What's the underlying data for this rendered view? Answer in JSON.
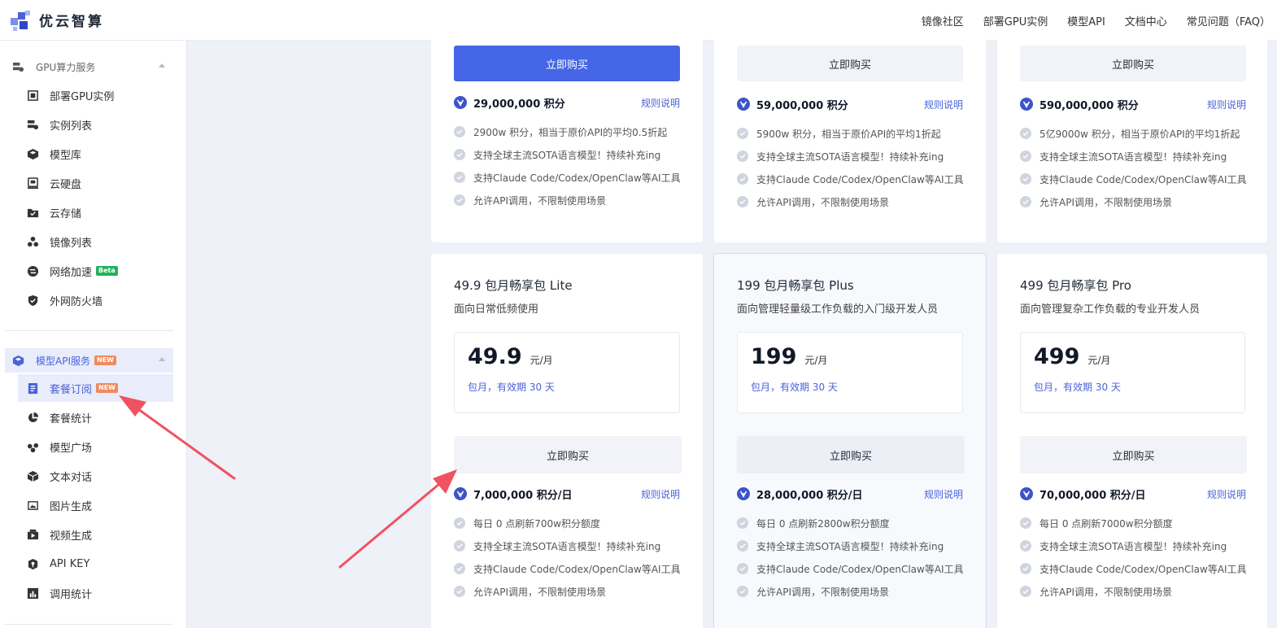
{
  "brand": {
    "name": "优云智算"
  },
  "topnav": [
    {
      "label": "镜像社区"
    },
    {
      "label": "部署GPU实例"
    },
    {
      "label": "模型API"
    },
    {
      "label": "文档中心"
    },
    {
      "label": "常见问题（FAQ）"
    }
  ],
  "sidebar": {
    "groups": [
      {
        "label": "GPU算力服务",
        "icon": "server-icon",
        "items": [
          {
            "label": "部署GPU实例",
            "icon": "deploy-icon"
          },
          {
            "label": "实例列表",
            "icon": "instance-list-icon"
          },
          {
            "label": "模型库",
            "icon": "model-library-icon"
          },
          {
            "label": "云硬盘",
            "icon": "cloud-disk-icon"
          },
          {
            "label": "云存储",
            "icon": "cloud-storage-icon"
          },
          {
            "label": "镜像列表",
            "icon": "image-list-icon"
          },
          {
            "label": "网络加速",
            "icon": "network-accel-icon",
            "badge": "Beta"
          },
          {
            "label": "外网防火墙",
            "icon": "firewall-icon"
          }
        ]
      },
      {
        "label": "模型API服务",
        "icon": "cube-icon",
        "badge": "NEW",
        "items": [
          {
            "label": "套餐订阅",
            "icon": "subscription-icon",
            "badge": "NEW",
            "active": true
          },
          {
            "label": "套餐统计",
            "icon": "pie-chart-icon"
          },
          {
            "label": "模型广场",
            "icon": "model-plaza-icon"
          },
          {
            "label": "文本对话",
            "icon": "text-chat-icon"
          },
          {
            "label": "图片生成",
            "icon": "image-gen-icon"
          },
          {
            "label": "视频生成",
            "icon": "video-gen-icon"
          },
          {
            "label": "API KEY",
            "icon": "api-key-icon"
          },
          {
            "label": "调用统计",
            "icon": "bar-chart-icon"
          }
        ]
      }
    ]
  },
  "accent_color": "#4566e6",
  "top_cards": [
    {
      "button": "立即购买",
      "primary": true,
      "points": "29,000,000 积分",
      "rule": "规则说明",
      "features": [
        "2900w 积分，相当于原价API的平均0.5折起",
        "支持全球主流SOTA语言模型！持续补充ing",
        "支持Claude Code/Codex/OpenClaw等AI工具",
        "允许API调用，不限制使用场景"
      ]
    },
    {
      "button": "立即购买",
      "primary": false,
      "points": "59,000,000 积分",
      "rule": "规则说明",
      "features": [
        "5900w 积分，相当于原价API的平均1折起",
        "支持全球主流SOTA语言模型！持续补充ing",
        "支持Claude Code/Codex/OpenClaw等AI工具",
        "允许API调用，不限制使用场景"
      ]
    },
    {
      "button": "立即购买",
      "primary": false,
      "points": "590,000,000 积分",
      "rule": "规则说明",
      "features": [
        "5亿9000w 积分，相当于原价API的平均1折起",
        "支持全球主流SOTA语言模型！持续补充ing",
        "支持Claude Code/Codex/OpenClaw等AI工具",
        "允许API调用，不限制使用场景"
      ]
    }
  ],
  "plans": [
    {
      "title": "49.9 包月畅享包 Lite",
      "desc": "面向日常低频使用",
      "price": "49.9",
      "unit": "元/月",
      "validity": "包月，有效期 30 天",
      "button": "立即购买",
      "points": "7,000,000 积分/日",
      "rule": "规则说明",
      "features": [
        "每日 0 点刷新700w积分额度",
        "支持全球主流SOTA语言模型！持续补充ing",
        "支持Claude Code/Codex/OpenClaw等AI工具",
        "允许API调用，不限制使用场景"
      ]
    },
    {
      "title": "199 包月畅享包 Plus",
      "desc": "面向管理轻量级工作负载的入门级开发人员",
      "price": "199",
      "unit": "元/月",
      "validity": "包月，有效期 30 天",
      "button": "立即购买",
      "points": "28,000,000 积分/日",
      "rule": "规则说明",
      "features": [
        "每日 0 点刷新2800w积分额度",
        "支持全球主流SOTA语言模型！持续补充ing",
        "支持Claude Code/Codex/OpenClaw等AI工具",
        "允许API调用，不限制使用场景"
      ]
    },
    {
      "title": "499 包月畅享包 Pro",
      "desc": "面向管理复杂工作负载的专业开发人员",
      "price": "499",
      "unit": "元/月",
      "validity": "包月，有效期 30 天",
      "button": "立即购买",
      "points": "70,000,000 积分/日",
      "rule": "规则说明",
      "features": [
        "每日 0 点刷新7000w积分额度",
        "支持全球主流SOTA语言模型！持续补充ing",
        "支持Claude Code/Codex/OpenClaw等AI工具",
        "允许API调用，不限制使用场景"
      ]
    }
  ]
}
